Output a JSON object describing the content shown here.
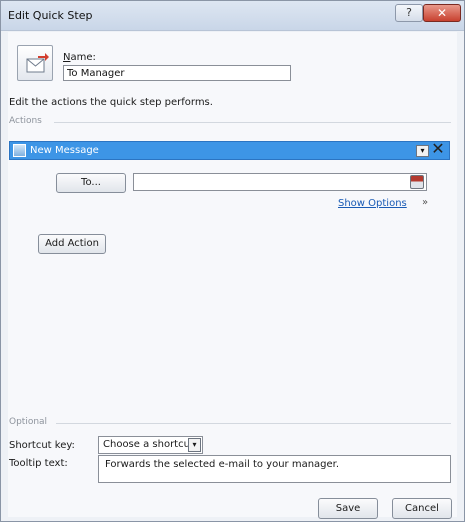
{
  "window": {
    "title": "Edit Quick Step",
    "help_glyph": "?",
    "close_glyph": "✕"
  },
  "name": {
    "label_first": "N",
    "label_rest": "ame:",
    "value": "To Manager"
  },
  "instruction": "Edit the actions the quick step performs.",
  "actions_group": {
    "label": "Actions",
    "action": {
      "icon": "new-message-icon",
      "label": "New Message",
      "dropdown_glyph": "▾",
      "remove_glyph": "✕"
    },
    "to_button_label": "To...",
    "recipients_value": "",
    "address_book_icon": "address-book-icon",
    "show_options_label": "Show Options",
    "chevron_glyph": "»"
  },
  "add_action_label": "Add Action",
  "optional_group": {
    "label": "Optional",
    "shortcut_label": "Shortcut key:",
    "shortcut_value": "Choose a shortcut",
    "shortcut_arrow": "▾",
    "tooltip_label": "Tooltip text:",
    "tooltip_value": "Forwards the selected e-mail to your manager."
  },
  "buttons": {
    "save": "Save",
    "cancel": "Cancel"
  },
  "colors": {
    "selected_action": "#3d95e6",
    "link": "#1a5bb5"
  }
}
